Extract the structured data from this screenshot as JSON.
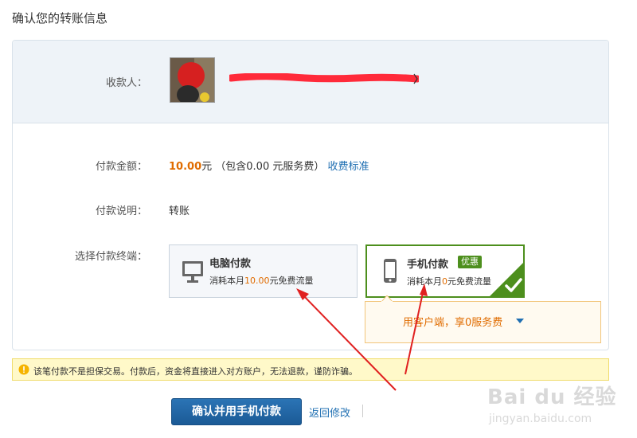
{
  "page": {
    "title": "确认您的转账信息"
  },
  "payee": {
    "label": "收款人：",
    "name_redacted": ""
  },
  "amount": {
    "label": "付款金额：",
    "value": "10.00",
    "unit": "元",
    "service_fee_note": "（包含0.00 元服务费）",
    "fee_link": "收费标准"
  },
  "note": {
    "label": "付款说明：",
    "value": "转账"
  },
  "terminal": {
    "label": "选择付款终端：",
    "options": [
      {
        "title": "电脑付款",
        "desc_prefix": "消耗本月",
        "desc_value": "10.00",
        "desc_suffix": "元免费流量",
        "icon": "desktop-icon",
        "selected": false
      },
      {
        "title": "手机付款",
        "badge": "优惠",
        "desc_prefix": "消耗本月",
        "desc_value": "0",
        "desc_suffix": "元免费流量",
        "icon": "mobile-icon",
        "selected": true
      }
    ],
    "tooltip": "用客户端，享0服务费"
  },
  "warning": {
    "text": "该笔付款不是担保交易。付款后，资金将直接进入对方账户，无法退款，谨防诈骗。"
  },
  "actions": {
    "confirm": "确认并用手机付款",
    "back": "返回修改"
  },
  "watermark": {
    "brand": "Bai du 经验",
    "url": "jingyan.baidu.com"
  },
  "colors": {
    "accent_blue": "#1f6fb2",
    "amount_orange": "#e06c00",
    "selected_green": "#4d8f1d",
    "warning_bg": "#fff9c9",
    "annotation_red": "#e02020"
  }
}
